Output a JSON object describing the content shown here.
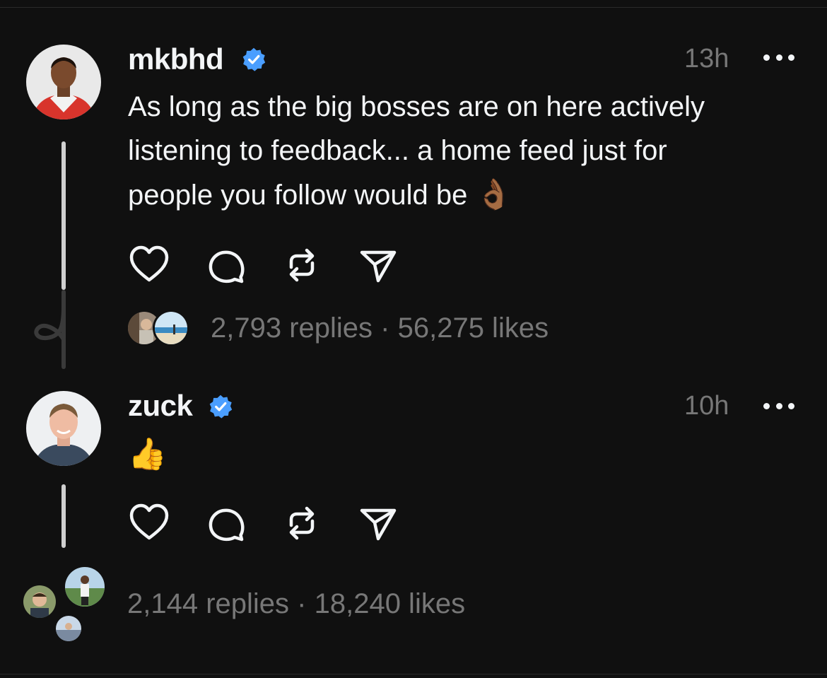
{
  "threads": [
    {
      "username": "mkbhd",
      "verified": true,
      "time": "13h",
      "text": "As long as the big bosses are on here actively\nlistening to feedback... a home feed just for\npeople you follow would be",
      "emoji": "👌🏾",
      "replies": "2,793 replies",
      "separator": " · ",
      "likes": "56,275 likes"
    },
    {
      "username": "zuck",
      "verified": true,
      "time": "10h",
      "emoji": "👍",
      "replies": "2,144 replies",
      "separator": " · ",
      "likes": "18,240 likes"
    }
  ],
  "colors": {
    "background": "#101010",
    "text": "#f3f5f7",
    "muted": "#777777",
    "verified": "#4a9eff",
    "thread_line": "#cfcfcf"
  },
  "icons": [
    "heart-icon",
    "comment-icon",
    "repost-icon",
    "share-icon",
    "more-icon",
    "verified-badge-icon"
  ]
}
